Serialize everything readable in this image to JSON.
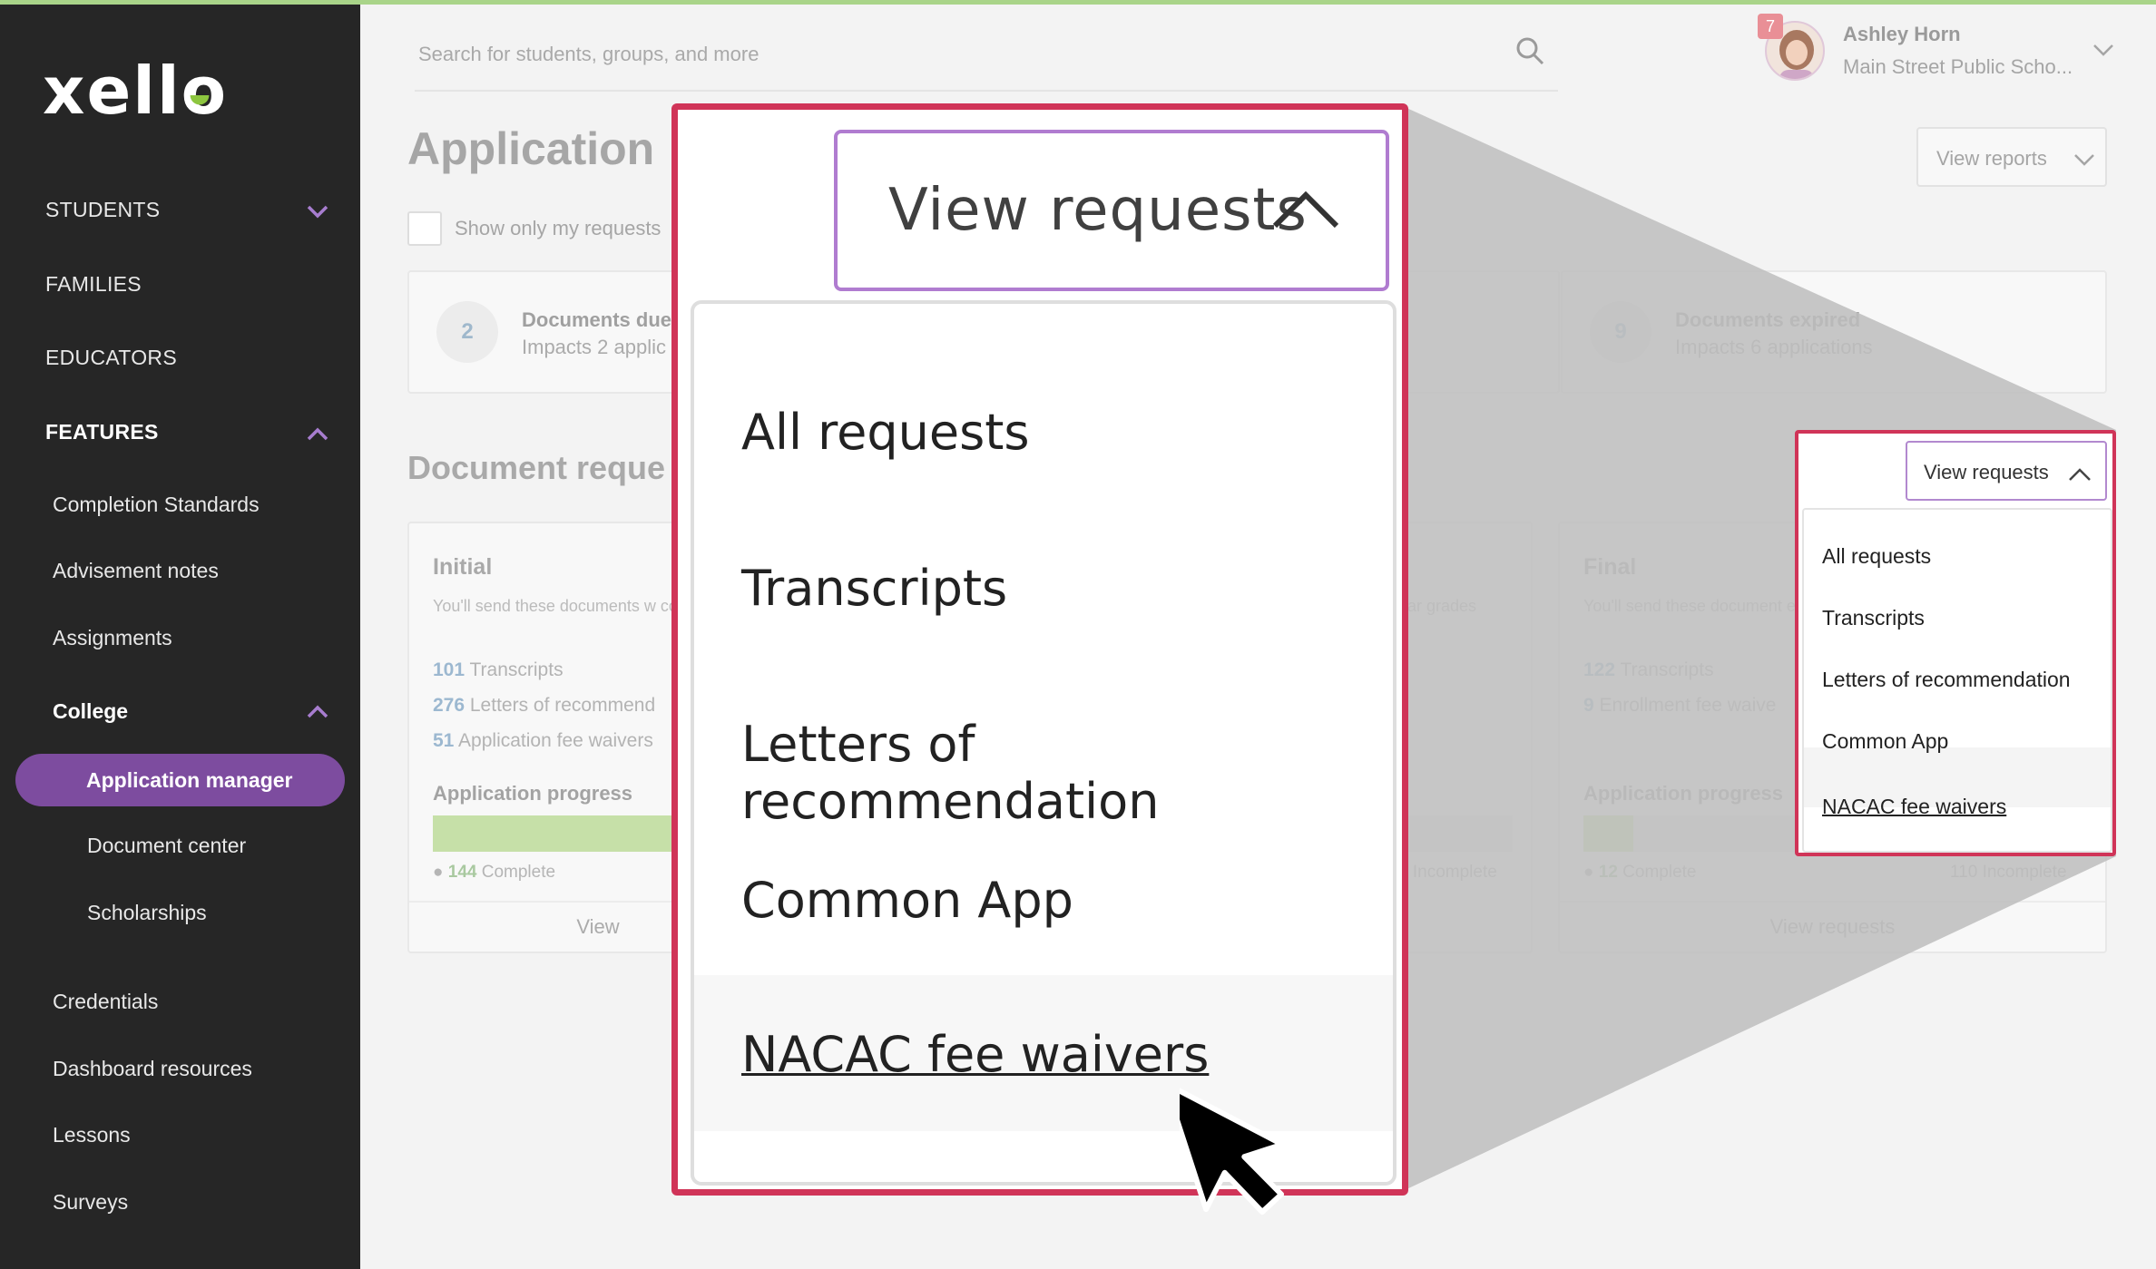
{
  "sidebar": {
    "logo": "xello",
    "nav": [
      {
        "label": "STUDENTS"
      },
      {
        "label": "FAMILIES"
      },
      {
        "label": "EDUCATORS"
      },
      {
        "label": "FEATURES"
      }
    ],
    "features": [
      {
        "label": "Completion Standards"
      },
      {
        "label": "Advisement notes"
      },
      {
        "label": "Assignments"
      },
      {
        "label": "College"
      }
    ],
    "college_items": [
      {
        "label": "Application manager",
        "active": true
      },
      {
        "label": "Document center"
      },
      {
        "label": "Scholarships"
      }
    ],
    "more": [
      {
        "label": "Credentials"
      },
      {
        "label": "Dashboard resources"
      },
      {
        "label": "Lessons"
      },
      {
        "label": "Surveys"
      }
    ]
  },
  "header": {
    "search_placeholder": "Search for students, groups, and more",
    "notification_count": "7",
    "user_name": "Ashley Horn",
    "school": "Main Street Public Scho..."
  },
  "page": {
    "title": "Application",
    "view_reports": "View reports",
    "show_only_mine": "Show only my requests",
    "stats": [
      {
        "num": "2",
        "title": "Documents due",
        "sub": "Impacts 2 applic"
      },
      {
        "num": "9",
        "title": "Documents expired",
        "sub": "Impacts 6 applications"
      }
    ],
    "section_title": "Document reque",
    "cards": [
      {
        "title": "Initial",
        "desc": "You'll send these documents w college applications.",
        "lines": [
          {
            "num": "101",
            "text": " Transcripts"
          },
          {
            "num": "276",
            "text": " Letters of recommend"
          },
          {
            "num": "51",
            "text": " Application fee waivers"
          }
        ],
        "progress_label": "Application progress",
        "progress": 0.82,
        "complete_num": "144",
        "complete_text": " Complete",
        "footer": "View"
      },
      {
        "mid_desc": "ar grades",
        "incomplete_fragment": "7 Incomplete"
      },
      {
        "title": "Final",
        "desc": "You'll send these document enrollment decisions.",
        "lines": [
          {
            "num": "122",
            "text": " Transcripts"
          },
          {
            "num": "9",
            "text": " Enrollment fee waive"
          }
        ],
        "progress_label": "Application progress",
        "progress": 0.1,
        "complete_num": "12",
        "complete_text": " Complete",
        "incomplete_text": "110 Incomplete",
        "footer": "View requests"
      }
    ]
  },
  "dropdown": {
    "button_label": "View requests",
    "options": [
      {
        "label": "All requests"
      },
      {
        "label": "Transcripts"
      },
      {
        "label": "Letters of recommendation"
      },
      {
        "label": "Common App"
      },
      {
        "label": "NACAC fee waivers",
        "hovered": true
      }
    ]
  },
  "colors": {
    "sidebar_bg": "#262626",
    "active_pill": "#7d4c9f",
    "highlight_frame": "#d03458",
    "button_border": "#b07cd0",
    "progress_fill": "#c6e0a8"
  }
}
